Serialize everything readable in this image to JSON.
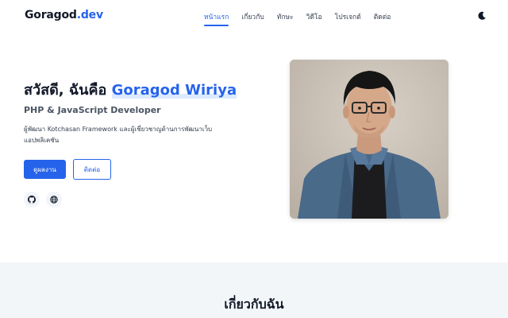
{
  "brand": {
    "name": "Goragod",
    "suffix": ".dev"
  },
  "nav": {
    "items": [
      {
        "label": "หน้าแรก",
        "active": true
      },
      {
        "label": "เกี่ยวกับ"
      },
      {
        "label": "ทักษะ"
      },
      {
        "label": "วิดีโอ"
      },
      {
        "label": "โปรเจกต์"
      },
      {
        "label": "ติดต่อ"
      }
    ],
    "theme_icon": "moon-icon"
  },
  "hero": {
    "greeting": "สวัสดี, ฉันคือ",
    "name": "Goragod Wiriya",
    "role": "PHP & JavaScript Developer",
    "description": "ผู้พัฒนา Kotchasan Framework และผู้เชี่ยวชาญด้านการพัฒนาเว็บแอปพลิเคชัน",
    "primary_button": "ดูผลงาน",
    "secondary_button": "ติดต่อ",
    "social_icons": [
      "github-icon",
      "globe-icon"
    ],
    "photo": "profile-photo"
  },
  "about": {
    "title": "เกี่ยวกับฉัน"
  },
  "colors": {
    "accent": "#2563eb",
    "about_bg": "#f3f6f8"
  }
}
